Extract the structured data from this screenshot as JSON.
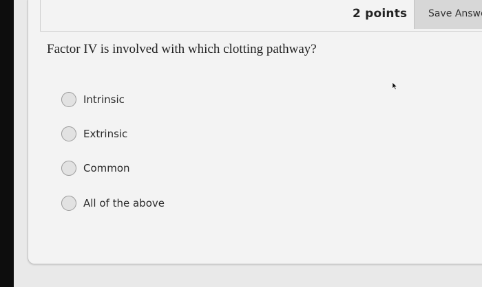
{
  "header": {
    "points": "2 points",
    "save_label": "Save Answe"
  },
  "question": {
    "text": "Factor IV is involved with which clotting pathway?"
  },
  "options": [
    {
      "label": "Intrinsic"
    },
    {
      "label": "Extrinsic"
    },
    {
      "label": "Common"
    },
    {
      "label": "All of the above"
    }
  ],
  "colors": {
    "bezel": "#0d0d0d",
    "card": "#f3f3f3",
    "save_button": "#d7d7d7",
    "text": "#222222"
  },
  "icons": {
    "cursor": "mouse-pointer-icon"
  }
}
